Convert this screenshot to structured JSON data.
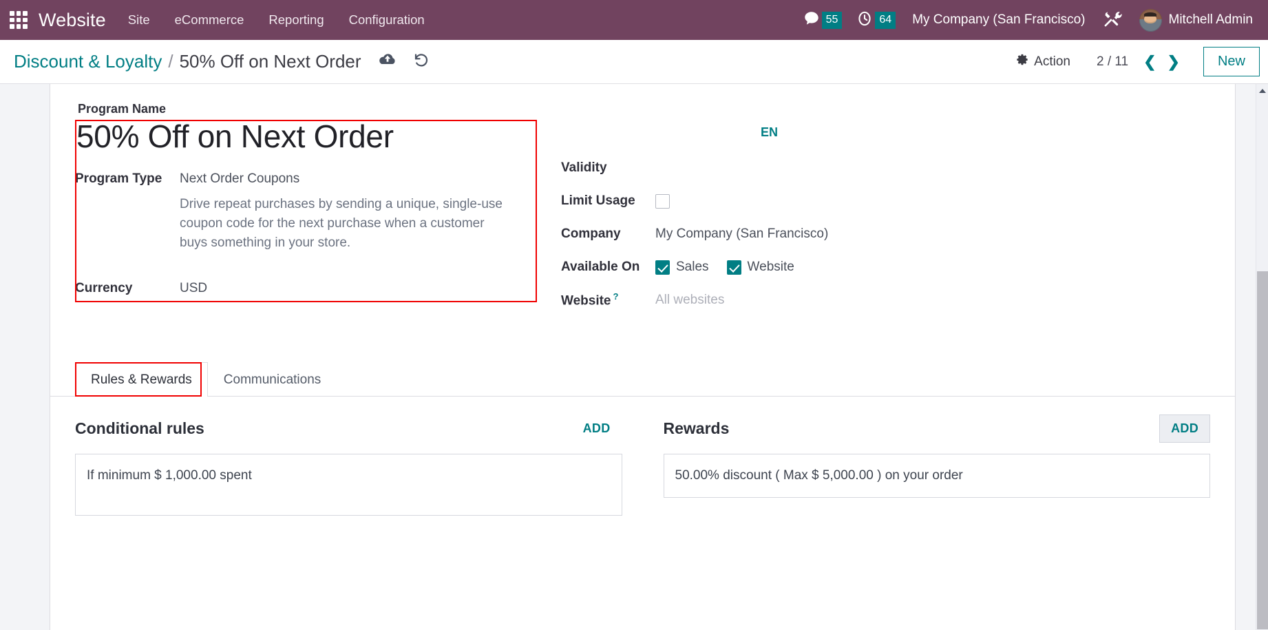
{
  "theme": {
    "navbar_bg": "#71435f",
    "accent": "#017e84",
    "badge_bg": "#017e84",
    "annotation": "#f00000",
    "page_bg": "#f3f4f7"
  },
  "navbar": {
    "apps_icon": "apps-grid-icon",
    "brand": "Website",
    "menu": [
      {
        "label": "Site"
      },
      {
        "label": "eCommerce"
      },
      {
        "label": "Reporting"
      },
      {
        "label": "Configuration"
      }
    ],
    "messages": {
      "icon": "comment-icon",
      "count": "55"
    },
    "activities": {
      "icon": "clock-icon",
      "count": "64"
    },
    "company": "My Company (San Francisco)",
    "debug_icon": "wrench-screwdriver-icon",
    "user": {
      "name": "Mitchell Admin",
      "avatar": "user-avatar"
    }
  },
  "control_panel": {
    "breadcrumb_parent": "Discount & Loyalty",
    "breadcrumb_separator": "/",
    "breadcrumb_current": "50% Off on Next Order",
    "save_icon": "cloud-upload-icon",
    "discard_icon": "undo-rotate-icon",
    "action_label": "Action",
    "action_icon": "gear-icon",
    "pager": "2 / 11",
    "pager_prev_icon": "chevron-left-icon",
    "pager_next_icon": "chevron-right-icon",
    "new_label": "New"
  },
  "form": {
    "program_name_label": "Program Name",
    "program_name_value": "50% Off on Next Order",
    "program_type_label": "Program Type",
    "program_type_value": "Next Order Coupons",
    "program_type_description": "Drive repeat purchases by sending a unique, single-use coupon code for the next purchase when a customer buys something in your store.",
    "currency_label": "Currency",
    "currency_value": "USD",
    "language_badge": "EN",
    "validity_label": "Validity",
    "validity_value": "",
    "limit_usage_label": "Limit Usage",
    "limit_usage_checked": false,
    "company_label": "Company",
    "company_value": "My Company (San Francisco)",
    "available_on_label": "Available On",
    "available_on": [
      {
        "label": "Sales",
        "checked": true
      },
      {
        "label": "Website",
        "checked": true
      }
    ],
    "website_label": "Website",
    "website_help": "?",
    "website_placeholder": "All websites"
  },
  "notebook": {
    "tabs": [
      {
        "label": "Rules & Rewards",
        "active": true
      },
      {
        "label": "Communications",
        "active": false
      }
    ],
    "conditional_rules": {
      "title": "Conditional rules",
      "add_label": "ADD",
      "items": [
        "If minimum $ 1,000.00 spent"
      ]
    },
    "rewards": {
      "title": "Rewards",
      "add_label": "ADD",
      "items": [
        "50.00% discount ( Max $ 5,000.00 ) on your order"
      ]
    }
  }
}
